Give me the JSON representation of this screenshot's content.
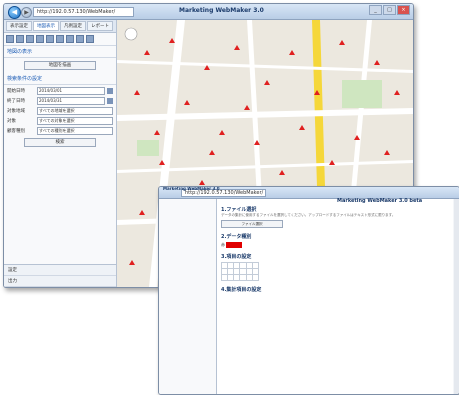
{
  "window1": {
    "address": "http://192.0.57.130/WebMaker/",
    "title": "Marketing WebMaker 3.0",
    "back_icon": "arrow-left-icon",
    "tabs": [
      "表示設定",
      "地図表示",
      "凡例設定",
      "レポート"
    ],
    "section_head": "地図の表示",
    "draw_button": "地図を描画",
    "condition_head": "検索条件の設定",
    "form": [
      {
        "label": "開始日時",
        "value": "2014/03/01"
      },
      {
        "label": "終了日時",
        "value": "2014/03/31"
      },
      {
        "label": "対象地域",
        "value": "すべての地域を選択"
      },
      {
        "label": "対象",
        "value": "すべての対象を選択"
      },
      {
        "label": "顧客種別",
        "value": "すべての種別を選択"
      }
    ],
    "search_button": "検索",
    "footer_items": [
      "設定",
      "出力"
    ]
  },
  "window2": {
    "address": "http://192.0.57.130/WebMaker/",
    "title": "Marketing WebMaker 3.0",
    "subtitle": "Marketing WebMaker 3.0 beta",
    "sections": [
      "1.ファイル選択",
      "2.データ種別",
      "3.項目の設定",
      "4.集計項目の設定"
    ],
    "note": "データの集計に使用するファイルを選択してください。アップロードするファイルはテキスト形式に限ります。",
    "browse_button": "ファイル選択",
    "sample_value": "赤"
  }
}
